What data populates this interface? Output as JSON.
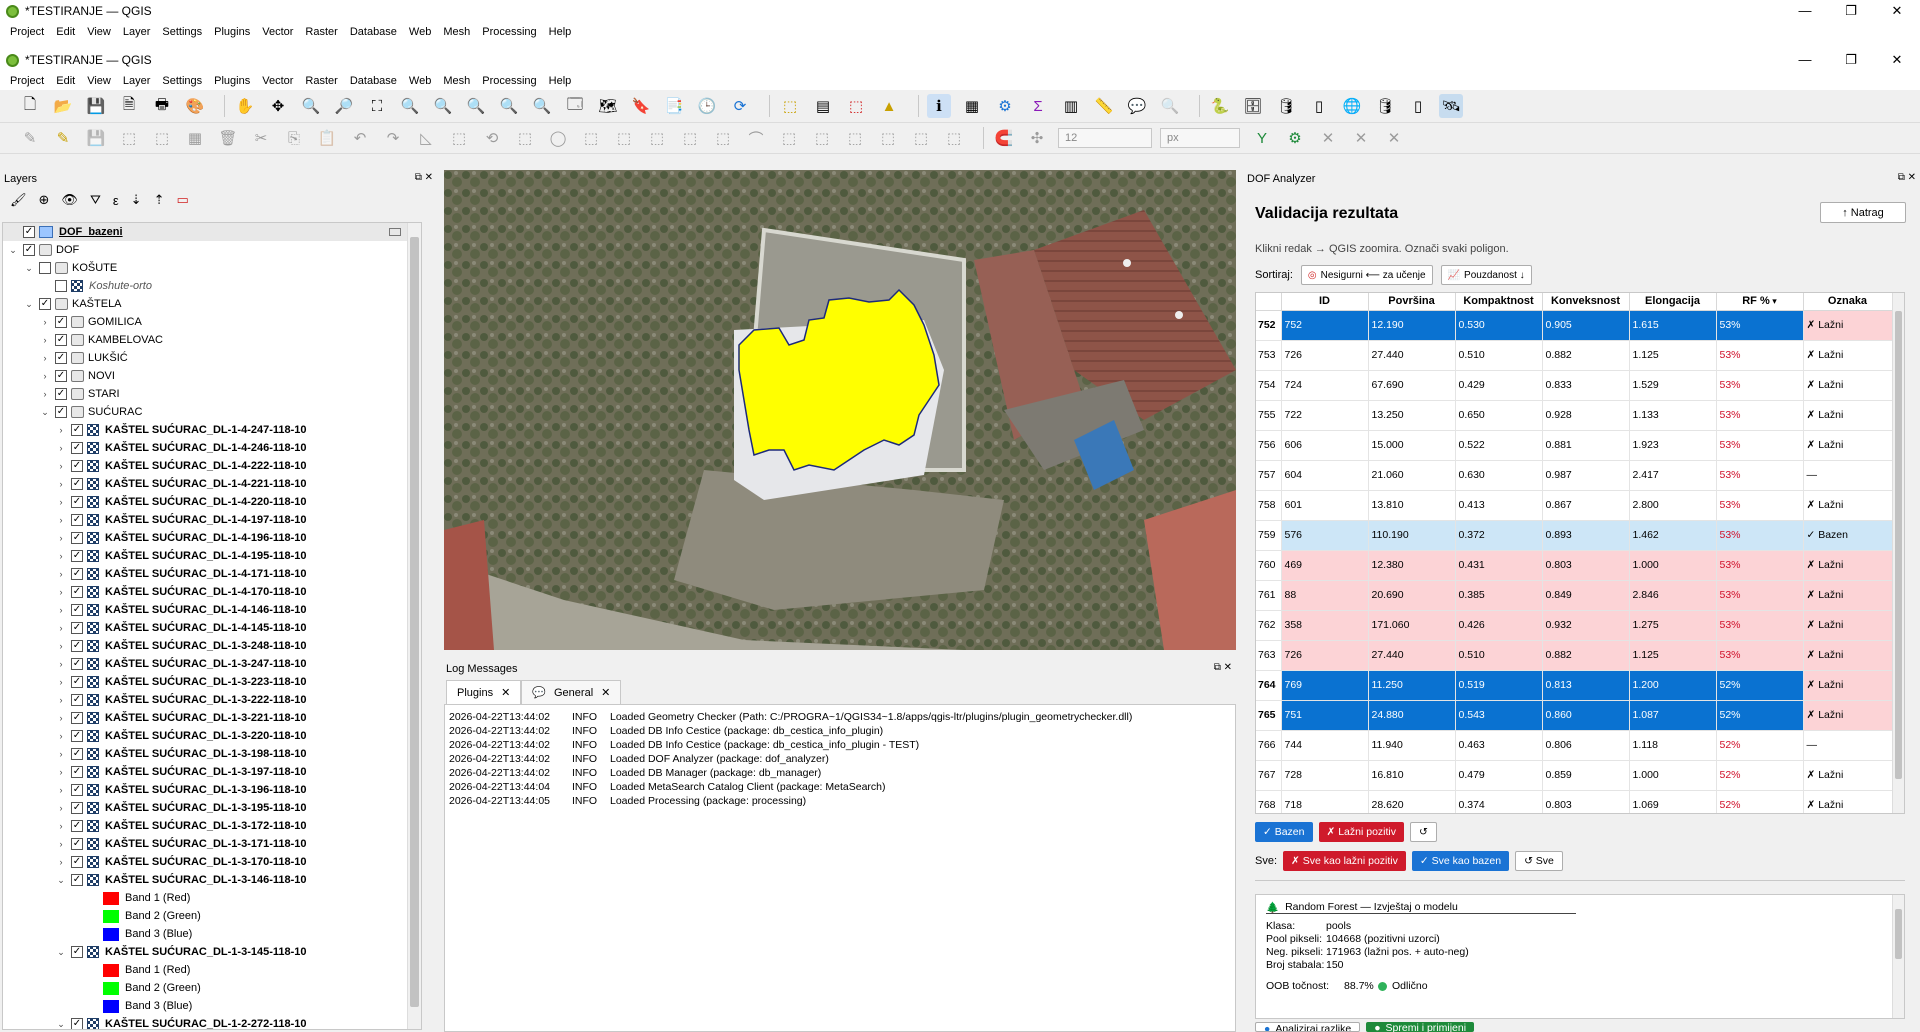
{
  "outer_window": {
    "title": "*TESTIRANJE — QGIS"
  },
  "inner_window": {
    "title": "*TESTIRANJE — QGIS"
  },
  "menu": [
    "Project",
    "Edit",
    "View",
    "Layer",
    "Settings",
    "Plugins",
    "Vector",
    "Raster",
    "Database",
    "Web",
    "Mesh",
    "Processing",
    "Help"
  ],
  "window_controls": {
    "minimize": "—",
    "maximize": "❐",
    "close": "✕"
  },
  "toolbar": {
    "size_value": "12",
    "unit_value": "px"
  },
  "layers_panel": {
    "title": "Layers",
    "items": [
      {
        "label": "DOF_bazeni",
        "type": "polygon",
        "level": 0,
        "checked": true,
        "bold": true,
        "underline": true
      },
      {
        "label": "DOF",
        "type": "group",
        "level": 0,
        "checked": true
      },
      {
        "label": "KOŠUTE",
        "type": "group",
        "level": 1,
        "checked": false
      },
      {
        "label": "Koshute-orto",
        "type": "raster",
        "level": 2,
        "checked": false,
        "italic": true
      },
      {
        "label": "KAŠTELA",
        "type": "group",
        "level": 1,
        "checked": true
      },
      {
        "label": "GOMILICA",
        "type": "group",
        "level": 2,
        "checked": true
      },
      {
        "label": "KAMBELOVAC",
        "type": "group",
        "level": 2,
        "checked": true
      },
      {
        "label": "LUKŠIĆ",
        "type": "group",
        "level": 2,
        "checked": true
      },
      {
        "label": "NOVI",
        "type": "group",
        "level": 2,
        "checked": true
      },
      {
        "label": "STARI",
        "type": "group",
        "level": 2,
        "checked": true
      },
      {
        "label": "SUĆURAC",
        "type": "group",
        "level": 2,
        "checked": true
      },
      {
        "label": "KAŠTEL SUĆURAC_DL-1-4-247-118-10",
        "type": "raster",
        "level": 3,
        "checked": true,
        "bold": true
      },
      {
        "label": "KAŠTEL SUĆURAC_DL-1-4-246-118-10",
        "type": "raster",
        "level": 3,
        "checked": true,
        "bold": true
      },
      {
        "label": "KAŠTEL SUĆURAC_DL-1-4-222-118-10",
        "type": "raster",
        "level": 3,
        "checked": true,
        "bold": true
      },
      {
        "label": "KAŠTEL SUĆURAC_DL-1-4-221-118-10",
        "type": "raster",
        "level": 3,
        "checked": true,
        "bold": true
      },
      {
        "label": "KAŠTEL SUĆURAC_DL-1-4-220-118-10",
        "type": "raster",
        "level": 3,
        "checked": true,
        "bold": true
      },
      {
        "label": "KAŠTEL SUĆURAC_DL-1-4-197-118-10",
        "type": "raster",
        "level": 3,
        "checked": true,
        "bold": true
      },
      {
        "label": "KAŠTEL SUĆURAC_DL-1-4-196-118-10",
        "type": "raster",
        "level": 3,
        "checked": true,
        "bold": true
      },
      {
        "label": "KAŠTEL SUĆURAC_DL-1-4-195-118-10",
        "type": "raster",
        "level": 3,
        "checked": true,
        "bold": true
      },
      {
        "label": "KAŠTEL SUĆURAC_DL-1-4-171-118-10",
        "type": "raster",
        "level": 3,
        "checked": true,
        "bold": true
      },
      {
        "label": "KAŠTEL SUĆURAC_DL-1-4-170-118-10",
        "type": "raster",
        "level": 3,
        "checked": true,
        "bold": true
      },
      {
        "label": "KAŠTEL SUĆURAC_DL-1-4-146-118-10",
        "type": "raster",
        "level": 3,
        "checked": true,
        "bold": true
      },
      {
        "label": "KAŠTEL SUĆURAC_DL-1-4-145-118-10",
        "type": "raster",
        "level": 3,
        "checked": true,
        "bold": true
      },
      {
        "label": "KAŠTEL SUĆURAC_DL-1-3-248-118-10",
        "type": "raster",
        "level": 3,
        "checked": true,
        "bold": true
      },
      {
        "label": "KAŠTEL SUĆURAC_DL-1-3-247-118-10",
        "type": "raster",
        "level": 3,
        "checked": true,
        "bold": true
      },
      {
        "label": "KAŠTEL SUĆURAC_DL-1-3-223-118-10",
        "type": "raster",
        "level": 3,
        "checked": true,
        "bold": true
      },
      {
        "label": "KAŠTEL SUĆURAC_DL-1-3-222-118-10",
        "type": "raster",
        "level": 3,
        "checked": true,
        "bold": true
      },
      {
        "label": "KAŠTEL SUĆURAC_DL-1-3-221-118-10",
        "type": "raster",
        "level": 3,
        "checked": true,
        "bold": true
      },
      {
        "label": "KAŠTEL SUĆURAC_DL-1-3-220-118-10",
        "type": "raster",
        "level": 3,
        "checked": true,
        "bold": true
      },
      {
        "label": "KAŠTEL SUĆURAC_DL-1-3-198-118-10",
        "type": "raster",
        "level": 3,
        "checked": true,
        "bold": true
      },
      {
        "label": "KAŠTEL SUĆURAC_DL-1-3-197-118-10",
        "type": "raster",
        "level": 3,
        "checked": true,
        "bold": true
      },
      {
        "label": "KAŠTEL SUĆURAC_DL-1-3-196-118-10",
        "type": "raster",
        "level": 3,
        "checked": true,
        "bold": true
      },
      {
        "label": "KAŠTEL SUĆURAC_DL-1-3-195-118-10",
        "type": "raster",
        "level": 3,
        "checked": true,
        "bold": true
      },
      {
        "label": "KAŠTEL SUĆURAC_DL-1-3-172-118-10",
        "type": "raster",
        "level": 3,
        "checked": true,
        "bold": true
      },
      {
        "label": "KAŠTEL SUĆURAC_DL-1-3-171-118-10",
        "type": "raster",
        "level": 3,
        "checked": true,
        "bold": true
      },
      {
        "label": "KAŠTEL SUĆURAC_DL-1-3-170-118-10",
        "type": "raster",
        "level": 3,
        "checked": true,
        "bold": true
      },
      {
        "label": "KAŠTEL SUĆURAC_DL-1-3-146-118-10",
        "type": "raster",
        "level": 3,
        "checked": true,
        "bold": true,
        "expanded": true
      },
      {
        "label": "Band 1 (Red)",
        "type": "band",
        "level": 4,
        "color": "#ff0000"
      },
      {
        "label": "Band 2 (Green)",
        "type": "band",
        "level": 4,
        "color": "#00ff00"
      },
      {
        "label": "Band 3 (Blue)",
        "type": "band",
        "level": 4,
        "color": "#0000ff"
      },
      {
        "label": "KAŠTEL SUĆURAC_DL-1-3-145-118-10",
        "type": "raster",
        "level": 3,
        "checked": true,
        "bold": true,
        "expanded": true
      },
      {
        "label": "Band 1 (Red)",
        "type": "band",
        "level": 4,
        "color": "#ff0000"
      },
      {
        "label": "Band 2 (Green)",
        "type": "band",
        "level": 4,
        "color": "#00ff00"
      },
      {
        "label": "Band 3 (Blue)",
        "type": "band",
        "level": 4,
        "color": "#0000ff"
      },
      {
        "label": "KAŠTEL SUĆURAC_DL-1-2-272-118-10",
        "type": "raster",
        "level": 3,
        "checked": true,
        "bold": true,
        "expanded": true
      }
    ]
  },
  "log_messages": {
    "title": "Log Messages",
    "tabs": [
      "Plugins",
      "General"
    ],
    "lines": [
      {
        "ts": "2026-04-22T13:44:02",
        "level": "INFO",
        "msg": "Loaded Geometry Checker (Path: C:/PROGRA~1/QGIS34~1.8/apps/qgis-ltr/plugins/plugin_geometrychecker.dll)"
      },
      {
        "ts": "2026-04-22T13:44:02",
        "level": "INFO",
        "msg": "Loaded DB Info Cestice (package: db_cestica_info_plugin)"
      },
      {
        "ts": "2026-04-22T13:44:02",
        "level": "INFO",
        "msg": "Loaded DB Info Cestice (package: db_cestica_info_plugin - TEST)"
      },
      {
        "ts": "2026-04-22T13:44:02",
        "level": "INFO",
        "msg": "Loaded DOF Analyzer (package: dof_analyzer)"
      },
      {
        "ts": "2026-04-22T13:44:02",
        "level": "INFO",
        "msg": "Loaded DB Manager (package: db_manager)"
      },
      {
        "ts": "2026-04-22T13:44:04",
        "level": "INFO",
        "msg": "Loaded MetaSearch Catalog Client (package: MetaSearch)"
      },
      {
        "ts": "2026-04-22T13:44:05",
        "level": "INFO",
        "msg": "Loaded Processing (package: processing)"
      }
    ]
  },
  "dof_panel": {
    "title": "DOF Analyzer",
    "heading": "Validacija rezultata",
    "back_label": "↑ Natrag",
    "hint": "Klikni redak → QGIS zoomira. Označi svaki poligon.",
    "sort_label": "Sortiraj:",
    "sort_btn1": "Nesigurni ⟵ za učenje",
    "sort_btn2": "Pouzdanost ↓",
    "columns": [
      "ID",
      "Površina",
      "Kompaktnost",
      "Konveksnost",
      "Elongacija",
      "RF %",
      "Oznaka"
    ],
    "rows": [
      {
        "row": "752",
        "id": "752",
        "area": "12.190",
        "comp": "0.530",
        "conv": "0.905",
        "elong": "1.615",
        "rf": "53%",
        "label": "✗ Lažni",
        "style": "sel"
      },
      {
        "row": "753",
        "id": "726",
        "area": "27.440",
        "comp": "0.510",
        "conv": "0.882",
        "elong": "1.125",
        "rf": "53%",
        "label": "✗ Lažni",
        "style": "white"
      },
      {
        "row": "754",
        "id": "724",
        "area": "67.690",
        "comp": "0.429",
        "conv": "0.833",
        "elong": "1.529",
        "rf": "53%",
        "label": "✗ Lažni",
        "style": "white"
      },
      {
        "row": "755",
        "id": "722",
        "area": "13.250",
        "comp": "0.650",
        "conv": "0.928",
        "elong": "1.133",
        "rf": "53%",
        "label": "✗ Lažni",
        "style": "white"
      },
      {
        "row": "756",
        "id": "606",
        "area": "15.000",
        "comp": "0.522",
        "conv": "0.881",
        "elong": "1.923",
        "rf": "53%",
        "label": "✗ Lažni",
        "style": "white"
      },
      {
        "row": "757",
        "id": "604",
        "area": "21.060",
        "comp": "0.630",
        "conv": "0.987",
        "elong": "2.417",
        "rf": "53%",
        "label": "—",
        "style": "white"
      },
      {
        "row": "758",
        "id": "601",
        "area": "13.810",
        "comp": "0.413",
        "conv": "0.867",
        "elong": "2.800",
        "rf": "53%",
        "label": "✗ Lažni",
        "style": "white"
      },
      {
        "row": "759",
        "id": "576",
        "area": "110.190",
        "comp": "0.372",
        "conv": "0.893",
        "elong": "1.462",
        "rf": "53%",
        "label": "✓ Bazen",
        "style": "blue"
      },
      {
        "row": "760",
        "id": "469",
        "area": "12.380",
        "comp": "0.431",
        "conv": "0.803",
        "elong": "1.000",
        "rf": "53%",
        "label": "✗ Lažni",
        "style": "pink"
      },
      {
        "row": "761",
        "id": "88",
        "area": "20.690",
        "comp": "0.385",
        "conv": "0.849",
        "elong": "2.846",
        "rf": "53%",
        "label": "✗ Lažni",
        "style": "pink"
      },
      {
        "row": "762",
        "id": "358",
        "area": "171.060",
        "comp": "0.426",
        "conv": "0.932",
        "elong": "1.275",
        "rf": "53%",
        "label": "✗ Lažni",
        "style": "pink"
      },
      {
        "row": "763",
        "id": "726",
        "area": "27.440",
        "comp": "0.510",
        "conv": "0.882",
        "elong": "1.125",
        "rf": "53%",
        "label": "✗ Lažni",
        "style": "pink"
      },
      {
        "row": "764",
        "id": "769",
        "area": "11.250",
        "comp": "0.519",
        "conv": "0.813",
        "elong": "1.200",
        "rf": "52%",
        "label": "✗ Lažni",
        "style": "sel"
      },
      {
        "row": "765",
        "id": "751",
        "area": "24.880",
        "comp": "0.543",
        "conv": "0.860",
        "elong": "1.087",
        "rf": "52%",
        "label": "✗ Lažni",
        "style": "sel"
      },
      {
        "row": "766",
        "id": "744",
        "area": "11.940",
        "comp": "0.463",
        "conv": "0.806",
        "elong": "1.118",
        "rf": "52%",
        "label": "—",
        "style": "white"
      },
      {
        "row": "767",
        "id": "728",
        "area": "16.810",
        "comp": "0.479",
        "conv": "0.859",
        "elong": "1.000",
        "rf": "52%",
        "label": "✗ Lažni",
        "style": "white"
      },
      {
        "row": "768",
        "id": "718",
        "area": "28.620",
        "comp": "0.374",
        "conv": "0.803",
        "elong": "1.069",
        "rf": "52%",
        "label": "✗ Lažni",
        "style": "white"
      }
    ],
    "btn_bazen": "✓ Bazen",
    "btn_lazni": "✗ Lažni pozitiv",
    "btn_refresh": "↺",
    "sve_label": "Sve:",
    "btn_sve_lazni": "✗ Sve kao lažni pozitiv",
    "btn_sve_bazen": "✓ Sve kao bazen",
    "btn_sve": "↺ Sve",
    "report": {
      "title": "Random Forest — Izvještaj o modelu",
      "lines": [
        {
          "k": "Klasa:",
          "v": "pools"
        },
        {
          "k": "Pool pikseli:",
          "v": "104668  (pozitivni uzorci)"
        },
        {
          "k": "Neg. pikseli:",
          "v": "171963  (lažni pos. + auto-neg)"
        },
        {
          "k": "Broj stabala:",
          "v": "150"
        }
      ],
      "oob_label": "OOB točnost:",
      "oob_value": "88.7%",
      "oob_status": "Odlično"
    },
    "btn_analyze": "Analiziraj razlike",
    "btn_save": "Spremi i primijeni"
  }
}
